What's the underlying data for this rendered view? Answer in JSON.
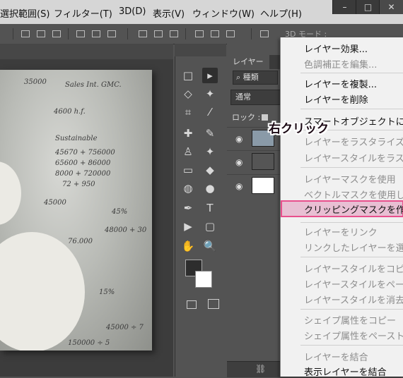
{
  "menu": {
    "items": [
      "選択範囲(S)",
      "フィルター(T)",
      "3D(D)",
      "表示(V)",
      "ウィンドウ(W)",
      "ヘルプ(H)"
    ],
    "window_buttons": [
      "–",
      "□",
      "✕"
    ]
  },
  "options_bar": {
    "mode_label": "3D モード :"
  },
  "canvas": {
    "scribbles": [
      "35000",
      "Sales Int. GMC.",
      "4600 h.f.",
      "Sustainable",
      "45670 + 756000",
      "65600 + 86000",
      "8000 + 720000",
      "72 + 950",
      "45000",
      "45%",
      "48000 + 30",
      "76.000",
      "15%",
      "45000 ÷ 7",
      "150000 ÷ 5"
    ]
  },
  "tools": [
    "□",
    "▸",
    "◇",
    "✦",
    "⌗",
    "⁄",
    "✚",
    "✎",
    "♙",
    "✦",
    "▭",
    "◆",
    "◍",
    "●",
    "✒",
    "T",
    "▶",
    "▢",
    "✋",
    "🔍"
  ],
  "layers_panel": {
    "tab_label": "レイヤー",
    "filter_label": "種類",
    "blend_mode": "通常",
    "lock_label": "ロック :",
    "bottom_icon": "link-icon"
  },
  "context_menu": {
    "items": [
      {
        "label": "レイヤー効果...",
        "disabled": false
      },
      {
        "label": "色調補正を編集...",
        "disabled": true
      },
      {
        "label": "レイヤーを複製...",
        "disabled": false
      },
      {
        "label": "レイヤーを削除",
        "disabled": false
      },
      {
        "label": "スマートオブジェクトに変",
        "disabled": false
      },
      {
        "label": "レイヤーをラスタライズ",
        "disabled": true
      },
      {
        "label": "レイヤースタイルをラスタ",
        "disabled": true
      },
      {
        "label": "レイヤーマスクを使用",
        "disabled": true
      },
      {
        "label": "ベクトルマスクを使用しな",
        "disabled": true
      },
      {
        "label": "クリッピングマスクを作成",
        "disabled": false,
        "highlighted": true
      },
      {
        "label": "レイヤーをリンク",
        "disabled": true
      },
      {
        "label": "リンクしたレイヤーを選択",
        "disabled": true
      },
      {
        "label": "レイヤースタイルをコピー",
        "disabled": true
      },
      {
        "label": "レイヤースタイルをペース",
        "disabled": true
      },
      {
        "label": "レイヤースタイルを消去",
        "disabled": true
      },
      {
        "label": "シェイプ属性をコピー",
        "disabled": true
      },
      {
        "label": "シェイプ属性をペースト",
        "disabled": true
      },
      {
        "label": "レイヤーを結合",
        "disabled": true
      },
      {
        "label": "表示レイヤーを結合",
        "disabled": false
      }
    ]
  },
  "annotation": {
    "label": "右クリック",
    "color": "#e8508d"
  }
}
